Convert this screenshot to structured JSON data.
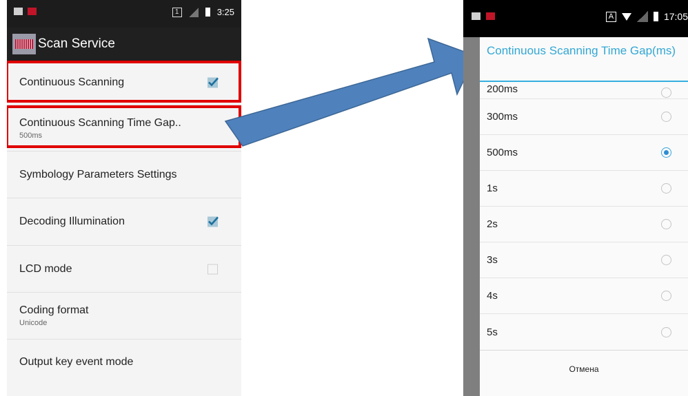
{
  "left_screen": {
    "status_bar": {
      "time": "3:25",
      "sim_number": "1"
    },
    "app_bar": {
      "title": "Scan Service",
      "icon": "barcode-app-icon"
    },
    "preferences": [
      {
        "title": "Continuous Scanning",
        "summary": "",
        "control": "checkbox",
        "checked": true,
        "highlighted": true
      },
      {
        "title": "Continuous Scanning Time Gap..",
        "summary": "500ms",
        "control": "none",
        "highlighted": true
      },
      {
        "title": "Symbology Parameters Settings",
        "summary": "",
        "control": "none",
        "highlighted": false
      },
      {
        "title": "Decoding Illumination",
        "summary": "",
        "control": "checkbox",
        "checked": true,
        "highlighted": false
      },
      {
        "title": "LCD mode",
        "summary": "",
        "control": "checkbox",
        "checked": false,
        "highlighted": false
      },
      {
        "title": "Coding format",
        "summary": "Unicode",
        "control": "none",
        "highlighted": false
      },
      {
        "title": "Output key event mode",
        "summary": "",
        "control": "none",
        "highlighted": false
      }
    ]
  },
  "right_screen": {
    "status_bar": {
      "time": "17:05",
      "input_indicator": "A"
    },
    "dialog": {
      "title": "Continuous Scanning Time Gap(ms)",
      "options": [
        {
          "label": "200ms",
          "selected": false
        },
        {
          "label": "300ms",
          "selected": false
        },
        {
          "label": "500ms",
          "selected": true
        },
        {
          "label": "1s",
          "selected": false
        },
        {
          "label": "2s",
          "selected": false
        },
        {
          "label": "3s",
          "selected": false
        },
        {
          "label": "4s",
          "selected": false
        },
        {
          "label": "5s",
          "selected": false
        }
      ],
      "cancel_label": "Отмена"
    }
  },
  "colors": {
    "highlight_frame": "#e00000",
    "arrow_fill": "#4f81bd",
    "dialog_accent": "#32a7d4",
    "radio_selected": "#2f8ed3",
    "checkbox_checked": "#a8c8d8"
  }
}
